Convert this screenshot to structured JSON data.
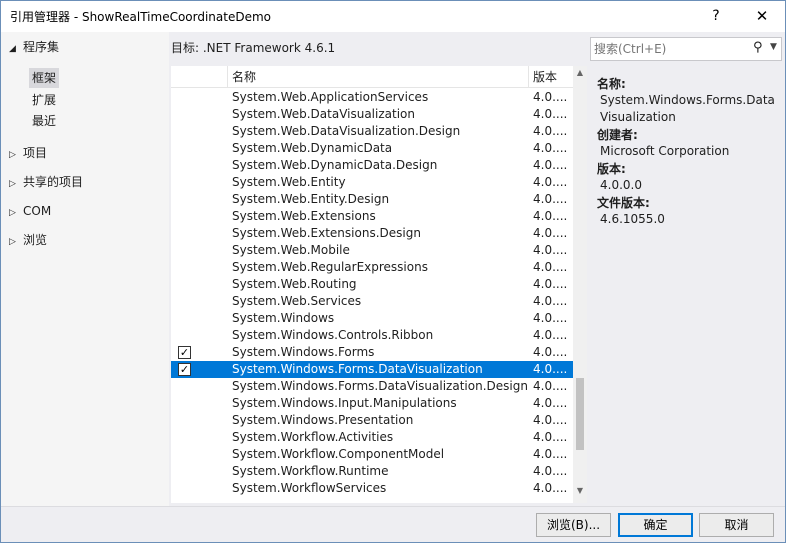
{
  "window": {
    "title": "引用管理器 - ShowRealTimeCoordinateDemo",
    "help_glyph": "?",
    "close_glyph": "✕"
  },
  "sidebar": {
    "assemblies_label": "程序集",
    "assemblies_children": [
      {
        "label": "框架",
        "selected": true
      },
      {
        "label": "扩展",
        "selected": false
      },
      {
        "label": "最近",
        "selected": false
      }
    ],
    "groups": [
      {
        "label": "项目"
      },
      {
        "label": "共享的项目"
      },
      {
        "label": "COM"
      },
      {
        "label": "浏览"
      }
    ]
  },
  "target_label": "目标: .NET Framework 4.6.1",
  "search": {
    "placeholder": "搜索(Ctrl+E)",
    "icon": "search-icon"
  },
  "list": {
    "columns": {
      "name": "名称",
      "version": "版本"
    },
    "rows": [
      {
        "name": "System.Web.ApplicationServices",
        "version": "4.0....",
        "checked": false,
        "selected": false
      },
      {
        "name": "System.Web.DataVisualization",
        "version": "4.0....",
        "checked": false,
        "selected": false
      },
      {
        "name": "System.Web.DataVisualization.Design",
        "version": "4.0....",
        "checked": false,
        "selected": false
      },
      {
        "name": "System.Web.DynamicData",
        "version": "4.0....",
        "checked": false,
        "selected": false
      },
      {
        "name": "System.Web.DynamicData.Design",
        "version": "4.0....",
        "checked": false,
        "selected": false
      },
      {
        "name": "System.Web.Entity",
        "version": "4.0....",
        "checked": false,
        "selected": false
      },
      {
        "name": "System.Web.Entity.Design",
        "version": "4.0....",
        "checked": false,
        "selected": false
      },
      {
        "name": "System.Web.Extensions",
        "version": "4.0....",
        "checked": false,
        "selected": false
      },
      {
        "name": "System.Web.Extensions.Design",
        "version": "4.0....",
        "checked": false,
        "selected": false
      },
      {
        "name": "System.Web.Mobile",
        "version": "4.0....",
        "checked": false,
        "selected": false
      },
      {
        "name": "System.Web.RegularExpressions",
        "version": "4.0....",
        "checked": false,
        "selected": false
      },
      {
        "name": "System.Web.Routing",
        "version": "4.0....",
        "checked": false,
        "selected": false
      },
      {
        "name": "System.Web.Services",
        "version": "4.0....",
        "checked": false,
        "selected": false
      },
      {
        "name": "System.Windows",
        "version": "4.0....",
        "checked": false,
        "selected": false
      },
      {
        "name": "System.Windows.Controls.Ribbon",
        "version": "4.0....",
        "checked": false,
        "selected": false
      },
      {
        "name": "System.Windows.Forms",
        "version": "4.0....",
        "checked": true,
        "selected": false
      },
      {
        "name": "System.Windows.Forms.DataVisualization",
        "version": "4.0....",
        "checked": true,
        "selected": true
      },
      {
        "name": "System.Windows.Forms.DataVisualization.Design",
        "version": "4.0....",
        "checked": false,
        "selected": false
      },
      {
        "name": "System.Windows.Input.Manipulations",
        "version": "4.0....",
        "checked": false,
        "selected": false
      },
      {
        "name": "System.Windows.Presentation",
        "version": "4.0....",
        "checked": false,
        "selected": false
      },
      {
        "name": "System.Workflow.Activities",
        "version": "4.0....",
        "checked": false,
        "selected": false
      },
      {
        "name": "System.Workflow.ComponentModel",
        "version": "4.0....",
        "checked": false,
        "selected": false
      },
      {
        "name": "System.Workflow.Runtime",
        "version": "4.0....",
        "checked": false,
        "selected": false
      },
      {
        "name": "System.WorkflowServices",
        "version": "4.0....",
        "checked": false,
        "selected": false
      }
    ]
  },
  "details": {
    "name_label": "名称:",
    "name_value": "System.Windows.Forms.DataVisualization",
    "creator_label": "创建者:",
    "creator_value": "Microsoft Corporation",
    "version_label": "版本:",
    "version_value": "4.0.0.0",
    "file_version_label": "文件版本:",
    "file_version_value": "4.6.1055.0"
  },
  "buttons": {
    "browse": "浏览(B)...",
    "ok": "确定",
    "cancel": "取消"
  }
}
